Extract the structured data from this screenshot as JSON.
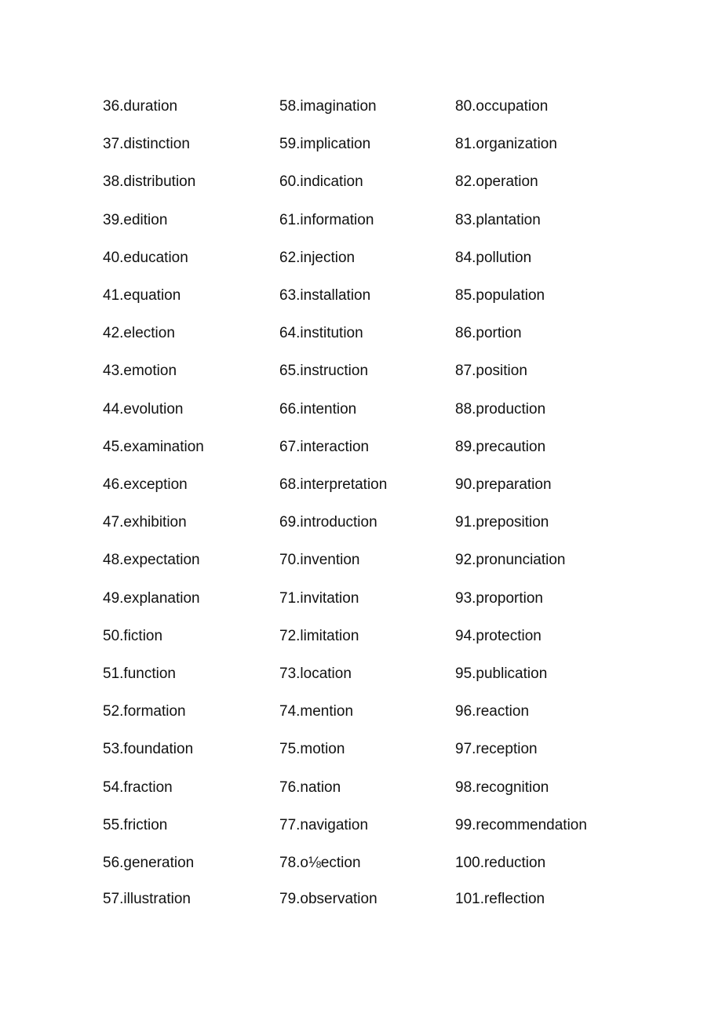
{
  "columns": [
    {
      "items": [
        "36.duration",
        "37.distinction",
        "38.distribution",
        "39.edition",
        "40.education",
        "41.equation",
        "42.election",
        "43.emotion",
        "44.evolution",
        "45.examination",
        "46.exception",
        "47.exhibition",
        "48.expectation",
        "49.explanation",
        "50.fiction",
        "51.function",
        "52.formation",
        "53.foundation",
        "54.fraction",
        "55.friction",
        "56.generation",
        "57.illustration"
      ]
    },
    {
      "items": [
        "58.imagination",
        "59.implication",
        "60.indication",
        "61.information",
        "62.injection",
        "63.installation",
        "64.institution",
        "65.instruction",
        "66.intention",
        "67.interaction",
        "68.interpretation",
        "69.introduction",
        "70.invention",
        "71.invitation",
        "72.limitation",
        "73.location",
        "74.mention",
        "75.motion",
        "76.nation",
        "77.navigation",
        "78.o⅛ection",
        "79.observation"
      ]
    },
    {
      "items": [
        "80.occupation",
        "81.organization",
        "82.operation",
        "83.plantation",
        "84.pollution",
        "85.population",
        "86.portion",
        "87.position",
        "88.production",
        "89.precaution",
        "90.preparation",
        "91.preposition",
        "92.pronunciation",
        "93.proportion",
        "94.protection",
        "95.publication",
        "96.reaction",
        "97.reception",
        "98.recognition",
        "99.recommendation",
        "100.reduction",
        "101.reflection"
      ]
    }
  ]
}
